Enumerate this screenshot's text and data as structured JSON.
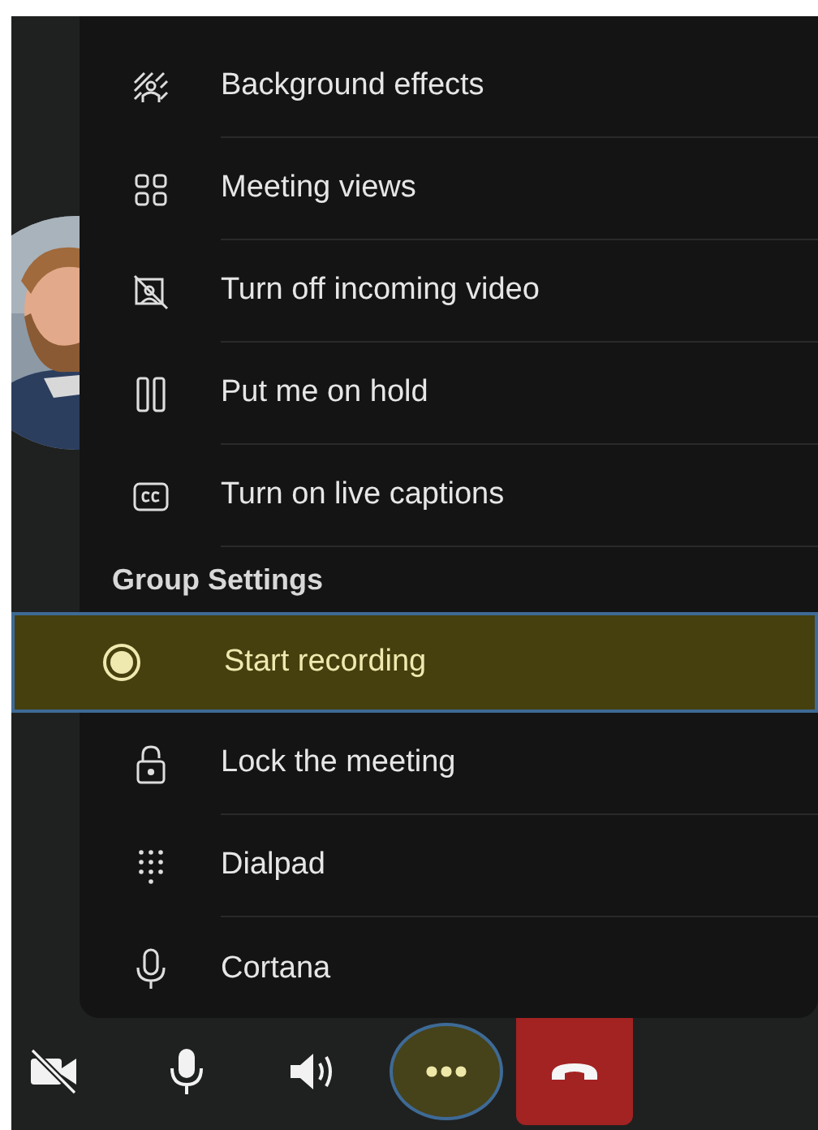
{
  "menu": {
    "items": [
      {
        "kind": "item",
        "label": "Background effects",
        "selected": false
      },
      {
        "kind": "item",
        "label": "Meeting views",
        "selected": false
      },
      {
        "kind": "item",
        "label": "Turn off incoming video",
        "selected": false
      },
      {
        "kind": "item",
        "label": "Put me on hold",
        "selected": false
      },
      {
        "kind": "item",
        "label": "Turn on live captions",
        "selected": false
      },
      {
        "kind": "header",
        "label": "Group Settings"
      },
      {
        "kind": "item",
        "label": "Start recording",
        "selected": true
      },
      {
        "kind": "item",
        "label": "Lock the meeting",
        "selected": false
      },
      {
        "kind": "item",
        "label": "Dialpad",
        "selected": false
      },
      {
        "kind": "item",
        "label": "Cortana",
        "selected": false
      }
    ]
  },
  "toolbar": [
    {
      "kind": "camera",
      "on": false,
      "selected": false
    },
    {
      "kind": "mic",
      "on": true,
      "selected": false
    },
    {
      "kind": "speaker",
      "on": true,
      "selected": false
    },
    {
      "kind": "more",
      "selected": true
    },
    {
      "kind": "hangup",
      "selected": false
    }
  ]
}
